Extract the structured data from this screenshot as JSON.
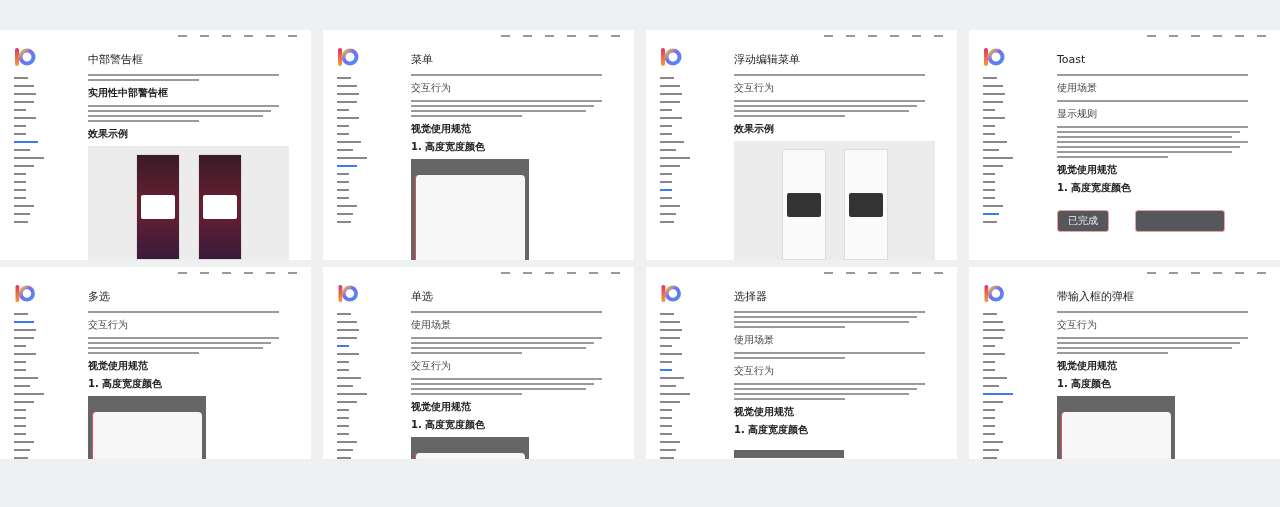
{
  "pages": [
    {
      "title": "中部警告框",
      "blocks": [
        {
          "kind": "short-paragraph"
        },
        {
          "kind": "heading",
          "text": "实用性中部警告框"
        },
        {
          "kind": "paragraph"
        },
        {
          "kind": "subheading",
          "text": "效果示例"
        }
      ],
      "figure": {
        "kind": "dark-phones"
      }
    },
    {
      "title": "菜单",
      "blocks": [
        {
          "kind": "line"
        },
        {
          "kind": "label",
          "text": "交互行为"
        },
        {
          "kind": "paragraph"
        },
        {
          "kind": "heading",
          "text": "视觉使用规范"
        },
        {
          "kind": "subheading",
          "text": "1. 高度宽度颜色"
        }
      ],
      "figure": {
        "kind": "frame"
      }
    },
    {
      "title": "浮动编辑菜单",
      "blocks": [
        {
          "kind": "line"
        },
        {
          "kind": "label",
          "text": "交互行为"
        },
        {
          "kind": "paragraph"
        },
        {
          "kind": "subheading",
          "text": "效果示例"
        }
      ],
      "figure": {
        "kind": "light-phones"
      }
    },
    {
      "title": "Toast",
      "blocks": [
        {
          "kind": "line"
        },
        {
          "kind": "label",
          "text": "使用场景"
        },
        {
          "kind": "line"
        },
        {
          "kind": "label",
          "text": "显示规则"
        },
        {
          "kind": "long-paragraph"
        },
        {
          "kind": "heading",
          "text": "视觉使用规范"
        },
        {
          "kind": "subheading",
          "text": "1. 高度宽度颜色"
        }
      ],
      "figure": {
        "kind": "toast",
        "label": "已完成"
      }
    },
    {
      "title": "多选",
      "blocks": [
        {
          "kind": "line"
        },
        {
          "kind": "label",
          "text": "交互行为"
        },
        {
          "kind": "paragraph"
        },
        {
          "kind": "heading",
          "text": "视觉使用规范"
        },
        {
          "kind": "subheading",
          "text": "1. 高度宽度颜色"
        }
      ],
      "figure": {
        "kind": "frame"
      }
    },
    {
      "title": "单选",
      "blocks": [
        {
          "kind": "line"
        },
        {
          "kind": "label",
          "text": "使用场景"
        },
        {
          "kind": "paragraph"
        },
        {
          "kind": "label",
          "text": "交互行为"
        },
        {
          "kind": "paragraph"
        },
        {
          "kind": "heading",
          "text": "视觉使用规范"
        },
        {
          "kind": "subheading",
          "text": "1. 高度宽度颜色"
        }
      ],
      "figure": {
        "kind": "frame"
      }
    },
    {
      "title": "选择器",
      "blocks": [
        {
          "kind": "paragraph"
        },
        {
          "kind": "label",
          "text": "使用场景"
        },
        {
          "kind": "short-paragraph"
        },
        {
          "kind": "label",
          "text": "交互行为"
        },
        {
          "kind": "paragraph"
        },
        {
          "kind": "heading",
          "text": "视觉使用规范"
        },
        {
          "kind": "subheading",
          "text": "1. 高度宽度颜色"
        }
      ],
      "figure": {
        "kind": "bar"
      }
    },
    {
      "title": "带输入框的弹框",
      "blocks": [
        {
          "kind": "line"
        },
        {
          "kind": "label",
          "text": "交互行为"
        },
        {
          "kind": "paragraph"
        },
        {
          "kind": "heading",
          "text": "视觉使用规范"
        },
        {
          "kind": "subheading",
          "text": "1. 高度颜色"
        }
      ],
      "figure": {
        "kind": "frame"
      }
    }
  ]
}
